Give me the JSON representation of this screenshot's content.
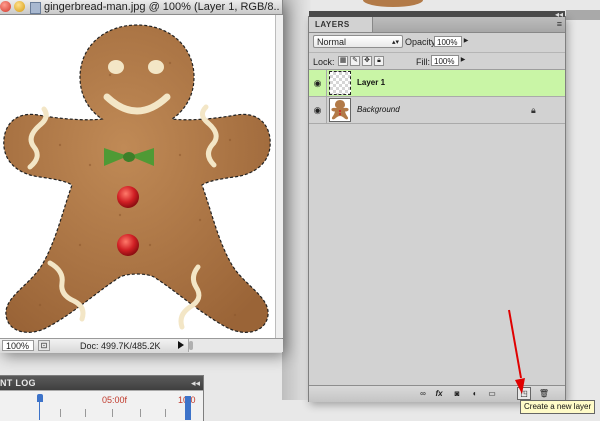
{
  "document": {
    "title": "gingerbread-man.jpg @ 100% (Layer 1, RGB/8...",
    "zoom": "100%",
    "doc_size": "Doc: 499.7K/485.2K"
  },
  "timeline": {
    "title": "NT LOG",
    "collapse": "◂◂",
    "mark_5": "05:00f",
    "mark_10": "10:0"
  },
  "layers_panel": {
    "tab_label": "LAYERS",
    "collapse": "◂◂",
    "menu_icon": "≡",
    "blend_mode": "Normal",
    "opacity_label": "Opacity:",
    "opacity_value": "100%",
    "lock_label": "Lock:",
    "fill_label": "Fill:",
    "fill_value": "100%",
    "layers": [
      {
        "name": "Layer 1",
        "selected": true,
        "thumb": "transparent"
      },
      {
        "name": "Background",
        "selected": false,
        "thumb": "gingerbread",
        "locked": true
      }
    ],
    "footer_icons": [
      "link-icon",
      "fx-icon",
      "mask-icon",
      "adjustment-icon",
      "group-icon",
      "new-layer-icon",
      "trash-icon"
    ]
  },
  "tooltip": "Create a new layer",
  "colors": {
    "selected_layer": "#c9f5a6",
    "cookie": "#b27a48",
    "icing": "#f3e6c6",
    "bowtie": "#4f9a35",
    "button": "#d01f24",
    "arrow": "#e00000"
  }
}
